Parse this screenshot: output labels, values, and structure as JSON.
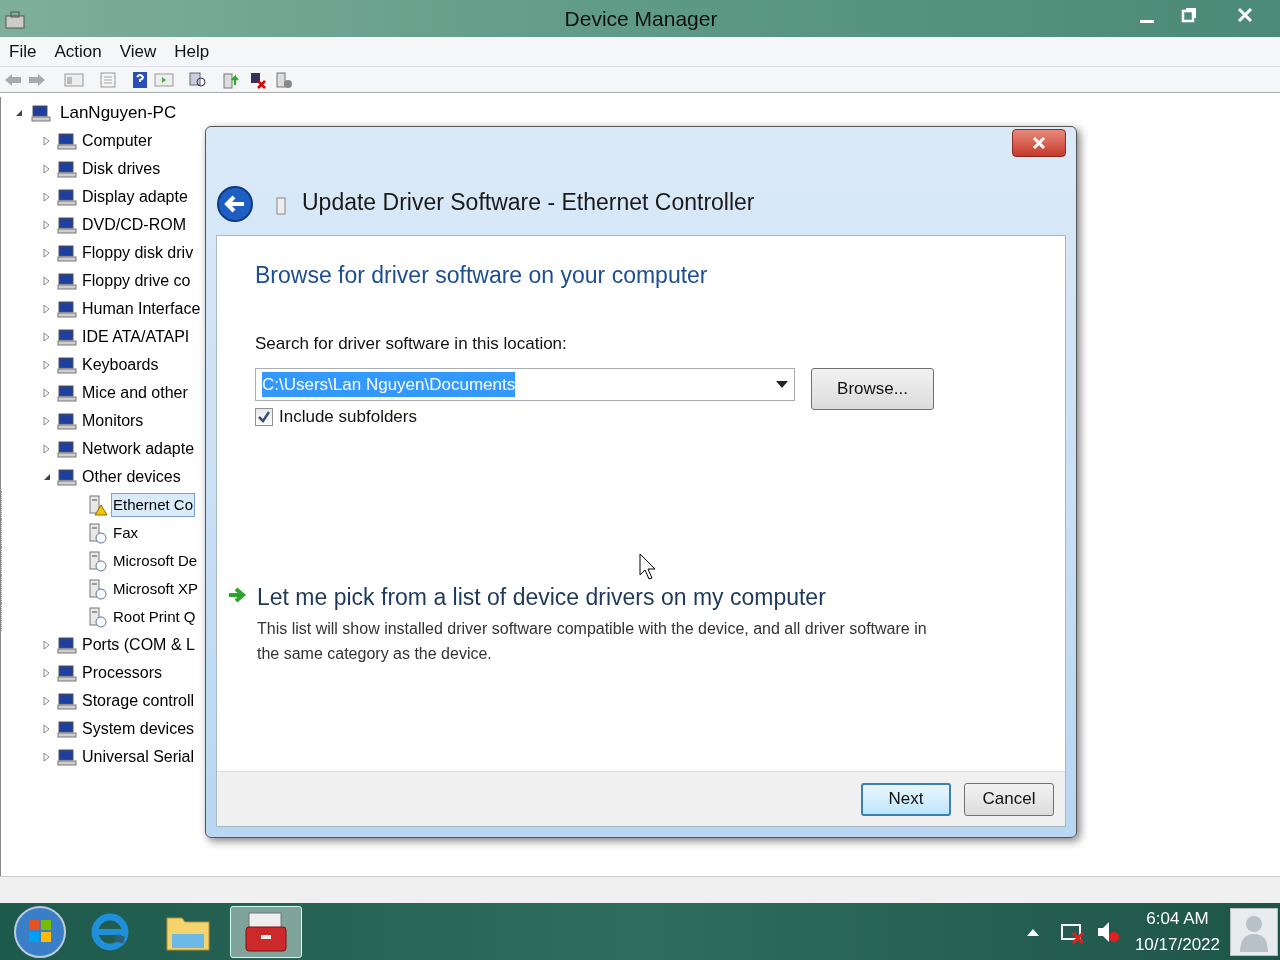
{
  "window": {
    "title": "Device Manager"
  },
  "menu": [
    "File",
    "Action",
    "View",
    "Help"
  ],
  "tree": {
    "label": "LanNguyen-PC",
    "expanded": true,
    "selected": false,
    "children": [
      {
        "label": "Computer",
        "expanded": false,
        "selected": false
      },
      {
        "label": "Disk drives",
        "expanded": false,
        "selected": false
      },
      {
        "label": "Display adapte",
        "expanded": false,
        "selected": false
      },
      {
        "label": "DVD/CD-ROM",
        "expanded": false,
        "selected": false
      },
      {
        "label": "Floppy disk driv",
        "expanded": false,
        "selected": false
      },
      {
        "label": "Floppy drive co",
        "expanded": false,
        "selected": false
      },
      {
        "label": "Human Interface",
        "expanded": false,
        "selected": false
      },
      {
        "label": "IDE ATA/ATAPI",
        "expanded": false,
        "selected": false
      },
      {
        "label": "Keyboards",
        "expanded": false,
        "selected": false
      },
      {
        "label": "Mice and other",
        "expanded": false,
        "selected": false
      },
      {
        "label": "Monitors",
        "expanded": false,
        "selected": false
      },
      {
        "label": "Network adapte",
        "expanded": false,
        "selected": false
      },
      {
        "label": "Other devices",
        "expanded": true,
        "selected": false,
        "children": [
          {
            "label": "Ethernet Co",
            "selected": true,
            "warning": true
          },
          {
            "label": "Fax",
            "selected": false,
            "warning": false
          },
          {
            "label": "Microsoft De",
            "selected": false,
            "warning": false
          },
          {
            "label": "Microsoft XP",
            "selected": false,
            "warning": false
          },
          {
            "label": "Root Print Q",
            "selected": false,
            "warning": false
          }
        ]
      },
      {
        "label": "Ports (COM & L",
        "expanded": false,
        "selected": false
      },
      {
        "label": "Processors",
        "expanded": false,
        "selected": false
      },
      {
        "label": "Storage controll",
        "expanded": false,
        "selected": false
      },
      {
        "label": "System devices",
        "expanded": false,
        "selected": false
      },
      {
        "label": "Universal Serial",
        "expanded": false,
        "selected": false
      }
    ]
  },
  "dialog": {
    "title": "Update Driver Software - Ethernet Controller",
    "heading": "Browse for driver software on your computer",
    "location_label": "Search for driver software in this location:",
    "location_value": "C:\\Users\\Lan Nguyen\\Documents",
    "browse_button": "Browse...",
    "include_subfolders": {
      "label": "Include subfolders",
      "checked": true
    },
    "pick_option": {
      "title": "Let me pick from a list of device drivers on my computer",
      "description": "This list will show installed driver software compatible with the device, and all driver software in the same category as the device."
    },
    "buttons": [
      {
        "label": "Next",
        "default": true
      },
      {
        "label": "Cancel",
        "default": false
      }
    ]
  },
  "taskbar": {
    "apps": [
      {
        "selected": false
      },
      {
        "selected": false
      },
      {
        "selected": true
      }
    ],
    "time": "6:04 AM",
    "date": "10/17/2022"
  }
}
